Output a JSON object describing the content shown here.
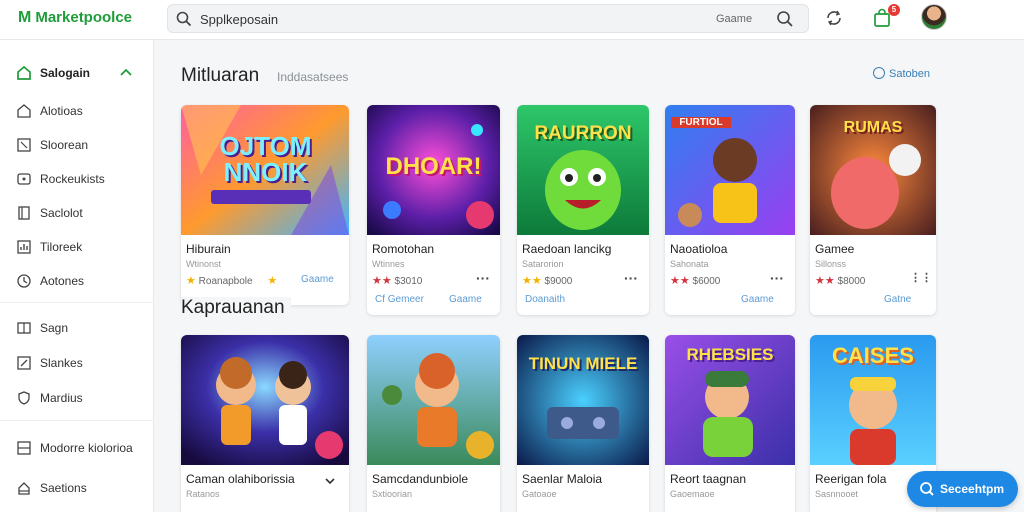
{
  "app": {
    "logo_letter": "M",
    "logo_text": "Marketpoolce"
  },
  "search": {
    "value": "Spplkeposain",
    "scope_label": "Gaame"
  },
  "notifications": {
    "count": "5"
  },
  "sidebar": {
    "items": [
      {
        "label": "Salogain",
        "icon": "home-icon"
      },
      {
        "label": "Alotioas",
        "icon": "house-icon"
      },
      {
        "label": "Sloorean",
        "icon": "square-icon"
      },
      {
        "label": "Rockeukists",
        "icon": "cart-icon"
      },
      {
        "label": "Saclolot",
        "icon": "book-icon"
      },
      {
        "label": "Tiloreek",
        "icon": "chart-icon"
      },
      {
        "label": "Aotones",
        "icon": "tag-icon"
      },
      {
        "label": "Sagn",
        "icon": "columns-icon"
      },
      {
        "label": "Slankes",
        "icon": "edit-icon"
      },
      {
        "label": "Mardius",
        "icon": "shield-icon"
      },
      {
        "label": "Modorre kiolorioa",
        "icon": "grid-icon"
      },
      {
        "label": "Saetions",
        "icon": "lock-icon"
      }
    ]
  },
  "sections": [
    {
      "title": "Mitluaran",
      "subtitle": "Inddasatsees",
      "see_all": "Satoben",
      "cards": [
        {
          "name": "Hiburain",
          "dev": "Wtinonst",
          "rating_label": "Roanapbole",
          "tag": "Gaame",
          "image_text": "OJTOM NNOIK"
        },
        {
          "name": "Romotohan",
          "dev": "Wtinnes",
          "rating_label": "$3010",
          "tag": "Cf Gemeer",
          "tag2": "Gaame",
          "image_text": "DHOAR!"
        },
        {
          "name": "Raedoan lancikg",
          "dev": "Satarorion",
          "rating_label": "$9000",
          "tag": "Doanaith",
          "image_text": "RAURRON"
        },
        {
          "name": "Naoatioloa",
          "dev": "Sahonata",
          "rating_label": "$6000",
          "tag": "Gaame",
          "image_text": "FURTIOL"
        },
        {
          "name": "Gamee",
          "dev": "Sillonss",
          "rating_label": "$8000",
          "tag": "Gatne",
          "image_text": "RUMAS"
        }
      ]
    },
    {
      "title": "Kaprauanan",
      "cards": [
        {
          "name": "Caman olahiborissia",
          "dev": "Ratanos",
          "image_text": ""
        },
        {
          "name": "Samcdandunbiole",
          "dev": "Sxtioorian",
          "image_text": ""
        },
        {
          "name": "Saenlar Maloia",
          "dev": "Gatoaoe",
          "image_text": "TINUN MIELE"
        },
        {
          "name": "Reort taagnan",
          "dev": "Gaoemaoe",
          "image_text": "RHEBSIES"
        },
        {
          "name": "Reerigan fola",
          "dev": "Sasnnooet",
          "image_text": "CAISES"
        }
      ]
    }
  ],
  "fab": {
    "label": "Seceehtpm"
  }
}
